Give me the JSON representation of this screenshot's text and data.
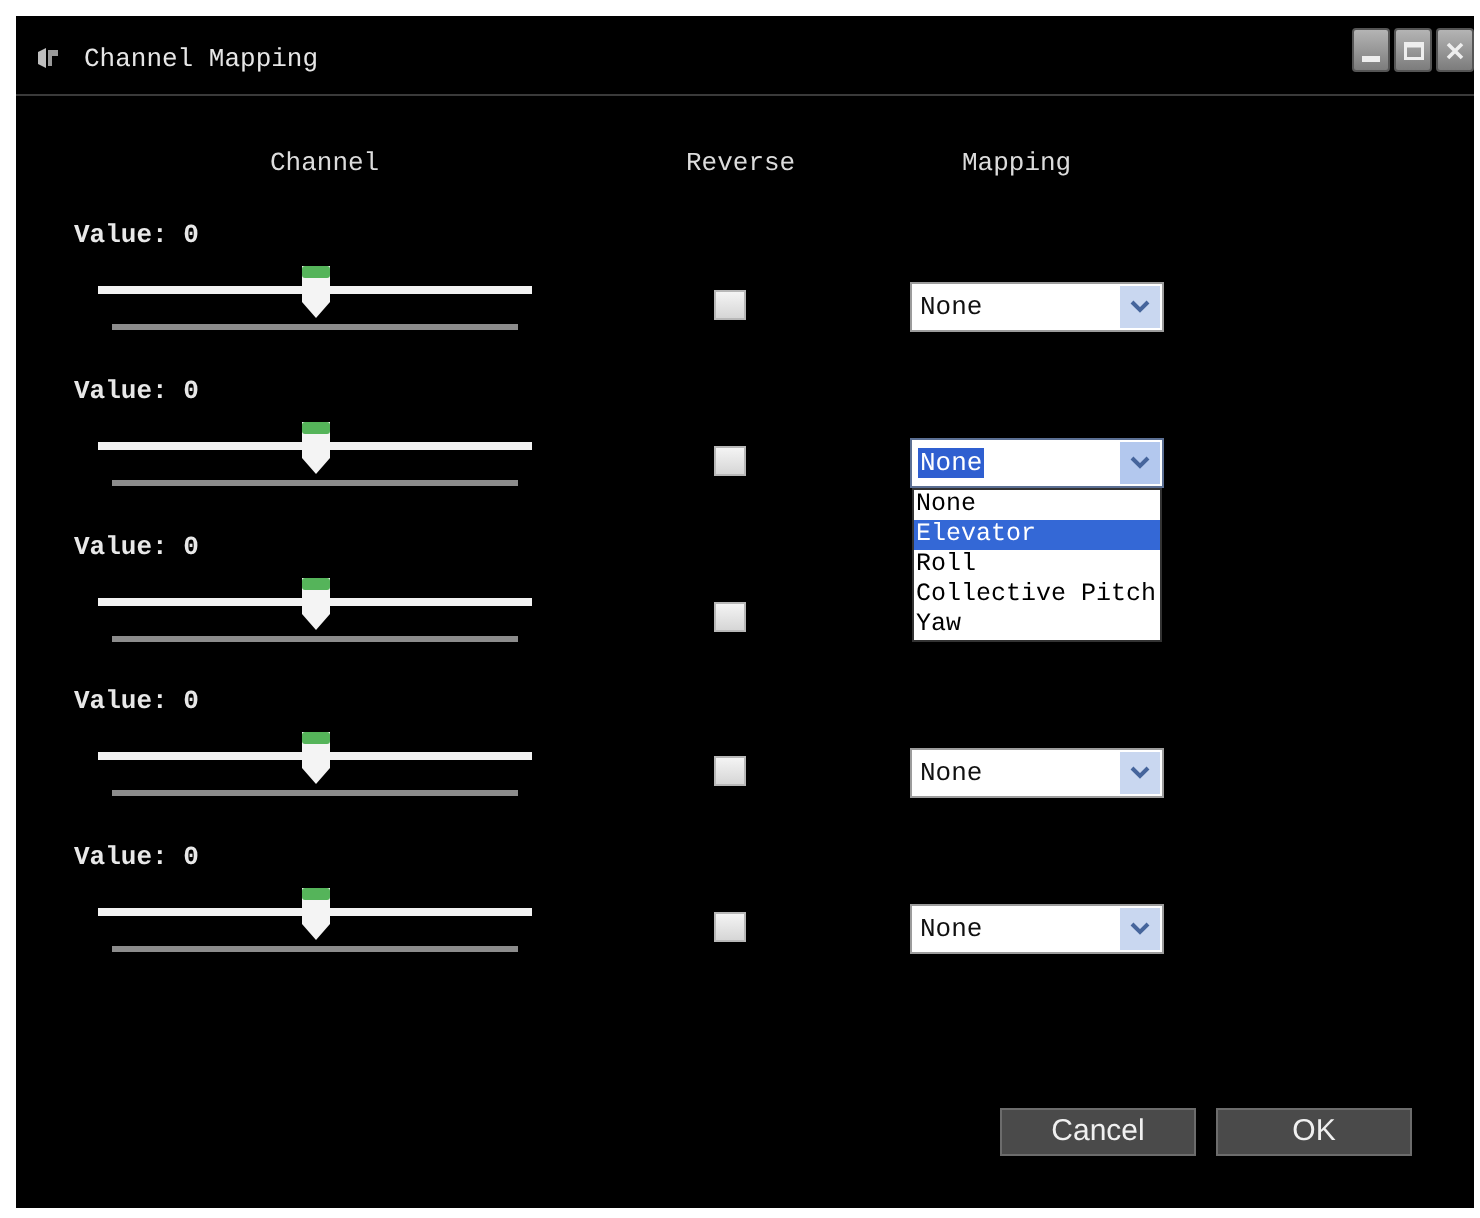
{
  "window": {
    "title": "Channel Mapping"
  },
  "columns": [
    "Channel",
    "Reverse",
    "Mapping"
  ],
  "channels": [
    {
      "value_label": "Value: 0",
      "level": 0.5,
      "reverse": false,
      "mapping": {
        "value": "None",
        "focused": false,
        "expanded": false
      }
    },
    {
      "value_label": "Value: 0",
      "level": 0.5,
      "reverse": false,
      "mapping": {
        "value": "None",
        "focused": true,
        "expanded": true
      }
    },
    {
      "value_label": "Value: 0",
      "level": 0.5,
      "reverse": false
    },
    {
      "value_label": "Value: 0",
      "level": 0.5,
      "reverse": false,
      "mapping": {
        "value": "None",
        "focused": false,
        "expanded": false
      }
    },
    {
      "value_label": "Value: 0",
      "level": 0.5,
      "reverse": false,
      "mapping": {
        "value": "None",
        "focused": false,
        "expanded": false
      }
    }
  ],
  "dropdown": {
    "options": [
      {
        "label": "None",
        "selected": false
      },
      {
        "label": "Elevator",
        "selected": true
      },
      {
        "label": "Roll",
        "selected": false
      },
      {
        "label": "Collective Pitch",
        "selected": false
      },
      {
        "label": "Yaw",
        "selected": false
      }
    ]
  },
  "buttons": [
    {
      "label": "Cancel"
    },
    {
      "label": "OK"
    }
  ]
}
